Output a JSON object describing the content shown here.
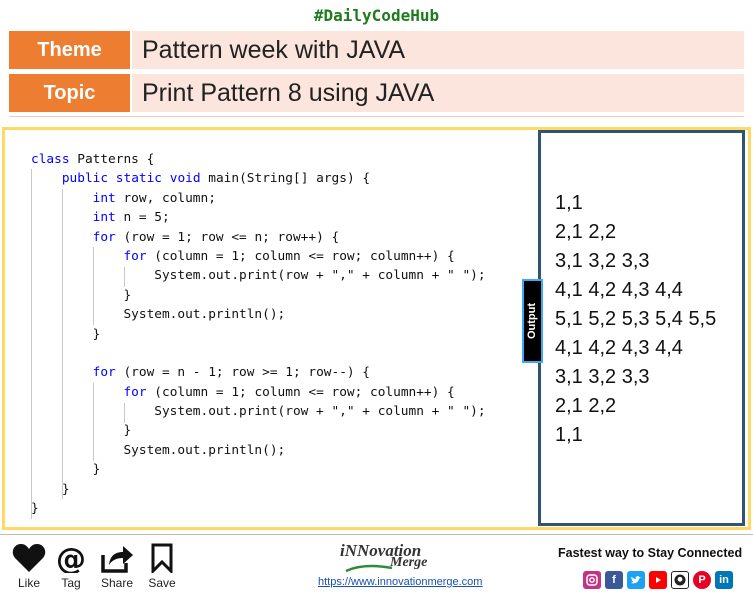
{
  "header": {
    "hashtag": "#DailyCodeHub",
    "theme_label": "Theme",
    "theme_value": "Pattern week with JAVA",
    "topic_label": "Topic",
    "topic_value": "Print Pattern 8 using JAVA"
  },
  "code": {
    "lines": [
      "class Patterns {",
      "    public static void main(String[] args) {",
      "        int row, column;",
      "        int n = 5;",
      "        for (row = 1; row <= n; row++) {",
      "            for (column = 1; column <= row; column++) {",
      "                System.out.print(row + \",\" + column + \" \");",
      "            }",
      "            System.out.println();",
      "        }",
      "",
      "        for (row = n - 1; row >= 1; row--) {",
      "            for (column = 1; column <= row; column++) {",
      "                System.out.print(row + \",\" + column + \" \");",
      "            }",
      "            System.out.println();",
      "        }",
      "    }",
      "}"
    ]
  },
  "output": {
    "tab_label": "Output",
    "lines": [
      "1,1",
      "2,1 2,2",
      "3,1 3,2 3,3",
      "4,1 4,2 4,3 4,4",
      "5,1 5,2 5,3 5,4 5,5",
      "4,1 4,2 4,3 4,4",
      "3,1 3,2 3,3",
      "2,1 2,2",
      "1,1"
    ]
  },
  "footer": {
    "actions": {
      "like": "Like",
      "tag": "Tag",
      "share": "Share",
      "save": "Save"
    },
    "brand_line1": "iNNovation",
    "brand_line2": "Merge",
    "site_url": "https://www.innovationmerge.com",
    "connect_text": "Fastest way to Stay Connected",
    "social_icons": [
      "instagram-icon",
      "facebook-icon",
      "twitter-icon",
      "youtube-icon",
      "github-icon",
      "pinterest-icon",
      "linkedin-icon"
    ]
  },
  "colors": {
    "accent_orange": "#ed7d31",
    "label_background": "#fbe5dc",
    "frame_yellow": "#ffd966",
    "output_border": "#2f5573",
    "hashtag_green": "#1e7b1e",
    "keyword_blue": "#0000ff"
  }
}
